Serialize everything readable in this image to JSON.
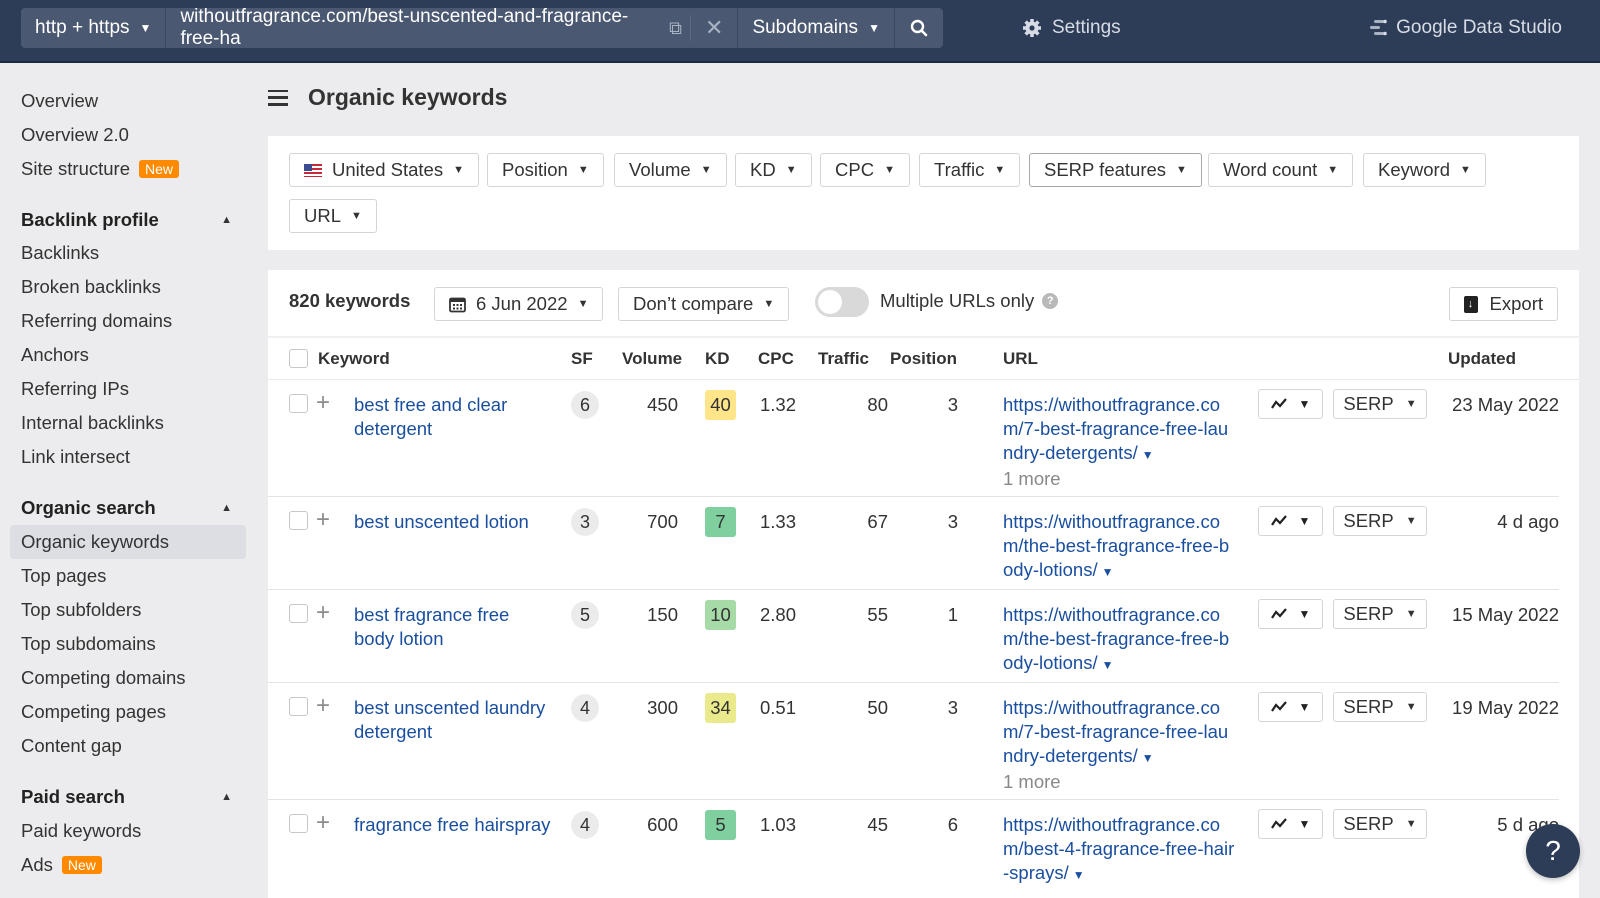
{
  "topbar": {
    "protocol": "http + https",
    "url": "withoutfragrance.com/best-unscented-and-fragrance-free-ha",
    "mode": "Subdomains",
    "settings_label": "Settings",
    "gds_label": "Google Data Studio",
    "icons": {
      "external": "external-link-icon",
      "clear": "close-icon",
      "search": "search-icon",
      "settings": "gear-icon",
      "gds": "data-studio-icon"
    }
  },
  "sidebar": {
    "items": [
      {
        "label": "Overview"
      },
      {
        "label": "Overview 2.0"
      },
      {
        "label": "Site structure",
        "badge": "New"
      }
    ],
    "sections": [
      {
        "title": "Backlink profile",
        "items": [
          "Backlinks",
          "Broken backlinks",
          "Referring domains",
          "Anchors",
          "Referring IPs",
          "Internal backlinks",
          "Link intersect"
        ]
      },
      {
        "title": "Organic search",
        "items": [
          "Organic keywords",
          "Top pages",
          "Top subfolders",
          "Top subdomains",
          "Competing domains",
          "Competing pages",
          "Content gap"
        ],
        "active": "Organic keywords"
      },
      {
        "title": "Paid search",
        "items": [
          "Paid keywords",
          "Ads"
        ],
        "badges": {
          "Ads": "New"
        }
      }
    ]
  },
  "page": {
    "title": "Organic keywords"
  },
  "filters": [
    "United States",
    "Position",
    "Volume",
    "KD",
    "CPC",
    "Traffic",
    "SERP features",
    "Word count",
    "Keyword",
    "URL"
  ],
  "toolbar": {
    "count": "820 keywords",
    "date": "6 Jun 2022",
    "compare": "Don’t compare",
    "multiple_urls_label": "Multiple URLs only",
    "multiple_urls_on": false,
    "export_label": "Export"
  },
  "table": {
    "columns": [
      "Keyword",
      "SF",
      "Volume",
      "KD",
      "CPC",
      "Traffic",
      "Position",
      "URL",
      "Updated"
    ],
    "serp_label": "SERP",
    "rows": [
      {
        "keyword": "best free and clear detergent",
        "sf": "6",
        "volume": "450",
        "kd": "40",
        "kd_color": "#ffe58a",
        "cpc": "1.32",
        "traffic": "80",
        "position": "3",
        "url": "https://withoutfragrance.com/7-best-fragrance-free-laundry-detergents/",
        "more": "1 more",
        "updated": "23 May 2022"
      },
      {
        "keyword": "best unscented lotion",
        "sf": "3",
        "volume": "700",
        "kd": "7",
        "kd_color": "#7fcf9f",
        "cpc": "1.33",
        "traffic": "67",
        "position": "3",
        "url": "https://withoutfragrance.com/the-best-fragrance-free-body-lotions/",
        "more": "",
        "updated": "4 d ago"
      },
      {
        "keyword": "best fragrance free body lotion",
        "sf": "5",
        "volume": "150",
        "kd": "10",
        "kd_color": "#a6dba8",
        "cpc": "2.80",
        "traffic": "55",
        "position": "1",
        "url": "https://withoutfragrance.com/the-best-fragrance-free-body-lotions/",
        "more": "",
        "updated": "15 May 2022"
      },
      {
        "keyword": "best unscented laundry detergent",
        "sf": "4",
        "volume": "300",
        "kd": "34",
        "kd_color": "#eaea8c",
        "cpc": "0.51",
        "traffic": "50",
        "position": "3",
        "url": "https://withoutfragrance.com/7-best-fragrance-free-laundry-detergents/",
        "more": "1 more",
        "updated": "19 May 2022"
      },
      {
        "keyword": "fragrance free hairspray",
        "sf": "4",
        "volume": "600",
        "kd": "5",
        "kd_color": "#7fcf9f",
        "cpc": "1.03",
        "traffic": "45",
        "position": "6",
        "url": "https://withoutfragrance.com/best-4-fragrance-free-hair-sprays/",
        "more": "",
        "updated": "5 d ago"
      }
    ]
  },
  "help_label": "?"
}
